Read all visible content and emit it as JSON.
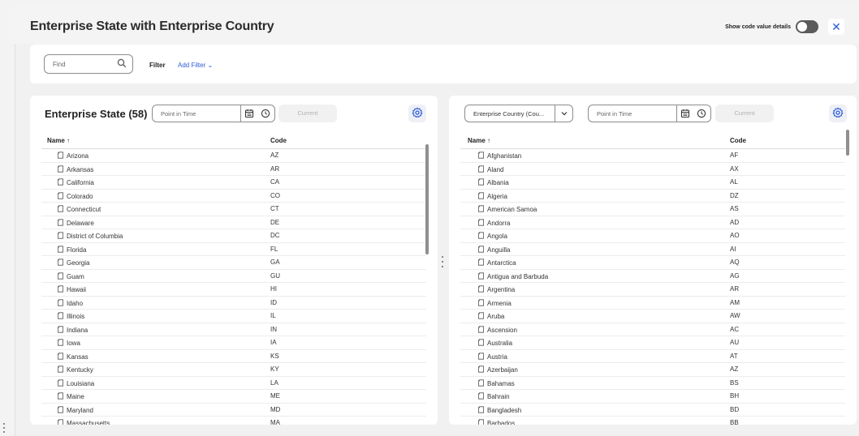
{
  "header": {
    "title": "Enterprise State with Enterprise Country",
    "code_toggle_label": "Show code value details",
    "close_symbol": "✕"
  },
  "filter_bar": {
    "find_placeholder": "Find",
    "filter_label": "Filter",
    "add_filter_label": "Add Filter ⌄"
  },
  "left_panel": {
    "title": "Enterprise State",
    "count": "(58)",
    "point_in_time_placeholder": "Point in Time",
    "current_label": "Current",
    "columns": {
      "name": "Name ↑",
      "code": "Code"
    },
    "rows": [
      {
        "name": "Arizona",
        "code": "AZ"
      },
      {
        "name": "Arkansas",
        "code": "AR"
      },
      {
        "name": "California",
        "code": "CA"
      },
      {
        "name": "Colorado",
        "code": "CO"
      },
      {
        "name": "Connecticut",
        "code": "CT"
      },
      {
        "name": "Delaware",
        "code": "DE"
      },
      {
        "name": "District of Columbia",
        "code": "DC"
      },
      {
        "name": "Florida",
        "code": "FL"
      },
      {
        "name": "Georgia",
        "code": "GA"
      },
      {
        "name": "Guam",
        "code": "GU"
      },
      {
        "name": "Hawaii",
        "code": "HI"
      },
      {
        "name": "Idaho",
        "code": "ID"
      },
      {
        "name": "Illinois",
        "code": "IL"
      },
      {
        "name": "Indiana",
        "code": "IN"
      },
      {
        "name": "Iowa",
        "code": "IA"
      },
      {
        "name": "Kansas",
        "code": "KS"
      },
      {
        "name": "Kentucky",
        "code": "KY"
      },
      {
        "name": "Louisiana",
        "code": "LA"
      },
      {
        "name": "Maine",
        "code": "ME"
      },
      {
        "name": "Maryland",
        "code": "MD"
      },
      {
        "name": "Massachusetts",
        "code": "MA"
      }
    ]
  },
  "right_panel": {
    "select_value": "Enterprise Country (Cou...",
    "point_in_time_placeholder": "Point in Time",
    "current_label": "Current",
    "columns": {
      "name": "Name ↑",
      "code": "Code"
    },
    "rows": [
      {
        "name": "Afghanistan",
        "code": "AF"
      },
      {
        "name": "Aland",
        "code": "AX"
      },
      {
        "name": "Albania",
        "code": "AL"
      },
      {
        "name": "Algeria",
        "code": "DZ"
      },
      {
        "name": "American Samoa",
        "code": "AS"
      },
      {
        "name": "Andorra",
        "code": "AD"
      },
      {
        "name": "Angola",
        "code": "AO"
      },
      {
        "name": "Anguilla",
        "code": "AI"
      },
      {
        "name": "Antarctica",
        "code": "AQ"
      },
      {
        "name": "Antigua and Barbuda",
        "code": "AG"
      },
      {
        "name": "Argentina",
        "code": "AR"
      },
      {
        "name": "Armenia",
        "code": "AM"
      },
      {
        "name": "Aruba",
        "code": "AW"
      },
      {
        "name": "Ascension",
        "code": "AC"
      },
      {
        "name": "Australia",
        "code": "AU"
      },
      {
        "name": "Austria",
        "code": "AT"
      },
      {
        "name": "Azerbaijan",
        "code": "AZ"
      },
      {
        "name": "Bahamas",
        "code": "BS"
      },
      {
        "name": "Bahrain",
        "code": "BH"
      },
      {
        "name": "Bangladesh",
        "code": "BD"
      },
      {
        "name": "Barbados",
        "code": "BB"
      }
    ]
  },
  "colors": {
    "accent": "#2a5bd7",
    "toggle_off": "#5b5b5b"
  }
}
